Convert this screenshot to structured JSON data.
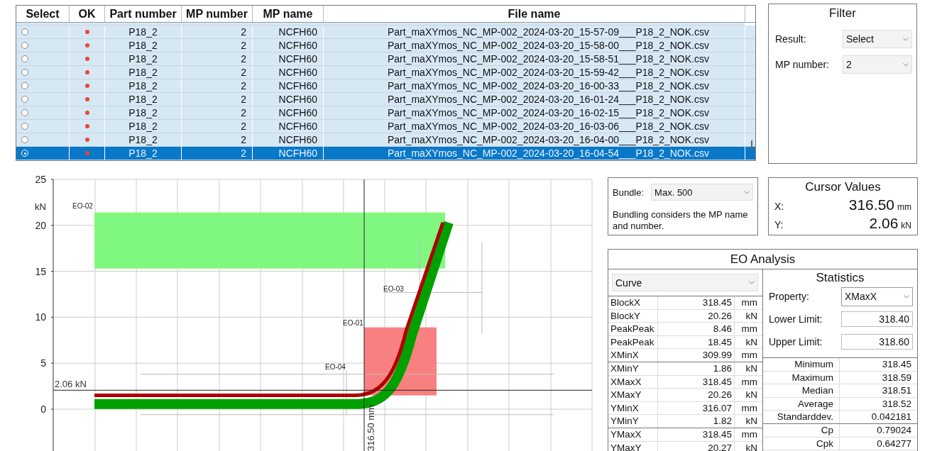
{
  "table": {
    "columns": [
      "Select",
      "OK",
      "Part number",
      "MP number",
      "MP name",
      "File name"
    ],
    "rows": [
      {
        "selected": false,
        "ok": false,
        "part_number": "P18_2",
        "mp_number": "2",
        "mp_name": "NCFH60",
        "file_name": "Part_maXYmos_NC_MP-002_2024-03-20_15-57-09___P18_2_NOK.csv"
      },
      {
        "selected": false,
        "ok": false,
        "part_number": "P18_2",
        "mp_number": "2",
        "mp_name": "NCFH60",
        "file_name": "Part_maXYmos_NC_MP-002_2024-03-20_15-58-00___P18_2_NOK.csv"
      },
      {
        "selected": false,
        "ok": false,
        "part_number": "P18_2",
        "mp_number": "2",
        "mp_name": "NCFH60",
        "file_name": "Part_maXYmos_NC_MP-002_2024-03-20_15-58-51___P18_2_NOK.csv"
      },
      {
        "selected": false,
        "ok": false,
        "part_number": "P18_2",
        "mp_number": "2",
        "mp_name": "NCFH60",
        "file_name": "Part_maXYmos_NC_MP-002_2024-03-20_15-59-42___P18_2_NOK.csv"
      },
      {
        "selected": false,
        "ok": false,
        "part_number": "P18_2",
        "mp_number": "2",
        "mp_name": "NCFH60",
        "file_name": "Part_maXYmos_NC_MP-002_2024-03-20_16-00-33___P18_2_NOK.csv"
      },
      {
        "selected": false,
        "ok": false,
        "part_number": "P18_2",
        "mp_number": "2",
        "mp_name": "NCFH60",
        "file_name": "Part_maXYmos_NC_MP-002_2024-03-20_16-01-24___P18_2_NOK.csv"
      },
      {
        "selected": false,
        "ok": false,
        "part_number": "P18_2",
        "mp_number": "2",
        "mp_name": "NCFH60",
        "file_name": "Part_maXYmos_NC_MP-002_2024-03-20_16-02-15___P18_2_NOK.csv"
      },
      {
        "selected": false,
        "ok": false,
        "part_number": "P18_2",
        "mp_number": "2",
        "mp_name": "NCFH60",
        "file_name": "Part_maXYmos_NC_MP-002_2024-03-20_16-03-06___P18_2_NOK.csv"
      },
      {
        "selected": false,
        "ok": false,
        "part_number": "P18_2",
        "mp_number": "2",
        "mp_name": "NCFH60",
        "file_name": "Part_maXYmos_NC_MP-002_2024-03-20_16-04-00___P18_2_NOK.csv"
      },
      {
        "selected": true,
        "ok": false,
        "part_number": "P18_2",
        "mp_number": "2",
        "mp_name": "NCFH60",
        "file_name": "Part_maXYmos_NC_MP-002_2024-03-20_16-04-54___P18_2_NOK.csv"
      }
    ]
  },
  "filter": {
    "title": "Filter",
    "fields": [
      {
        "label": "Result:",
        "value": "Select"
      },
      {
        "label": "MP number:",
        "value": "2"
      }
    ]
  },
  "plot": {
    "y_ticks": [
      "25",
      "20",
      "15",
      "10",
      "5",
      "0"
    ],
    "y_unit": "kN",
    "cursor_y_label": "2.06 kN",
    "cursor_x_label": "316.50 mm",
    "windows": [
      {
        "label": "EO-02"
      },
      {
        "label": "EO-03"
      },
      {
        "label": "EO-01"
      },
      {
        "label": "EO-04"
      }
    ]
  },
  "bundle": {
    "label": "Bundle:",
    "value": "Max. 500",
    "note": "Bundling considers the MP name and number."
  },
  "cursor_values": {
    "title": "Cursor Values",
    "rows": [
      {
        "label": "X:",
        "value": "316.50",
        "unit": "mm"
      },
      {
        "label": "Y:",
        "value": "2.06",
        "unit": "kN"
      }
    ]
  },
  "eo_analysis": {
    "title": "EO Analysis",
    "curve_select": "Curve",
    "results": [
      {
        "name": "BlockX",
        "value": "318.45",
        "unit": "mm"
      },
      {
        "name": "BlockY",
        "value": "20.26",
        "unit": "kN"
      },
      {
        "name": "PeakPeak",
        "value": "8.46",
        "unit": "mm"
      },
      {
        "name": "PeakPeak",
        "value": "18.45",
        "unit": "kN"
      },
      {
        "name": "XMinX",
        "value": "309.99",
        "unit": "mm"
      },
      {
        "name": "XMinY",
        "value": "1.86",
        "unit": "kN"
      },
      {
        "name": "XMaxX",
        "value": "318.45",
        "unit": "mm"
      },
      {
        "name": "XMaxY",
        "value": "20.26",
        "unit": "kN"
      },
      {
        "name": "YMinX",
        "value": "316.07",
        "unit": "mm"
      },
      {
        "name": "YMinY",
        "value": "1.82",
        "unit": "kN"
      },
      {
        "name": "YMaxX",
        "value": "318.45",
        "unit": "mm"
      },
      {
        "name": "YMaxY",
        "value": "20.27",
        "unit": "kN"
      }
    ],
    "statistics": {
      "title": "Statistics",
      "property_label": "Property:",
      "property": "XMaxX",
      "lower_label": "Lower Limit:",
      "lower": "318.40",
      "upper_label": "Upper Limit:",
      "upper": "318.60",
      "rows": [
        {
          "name": "Minimum",
          "value": "318.45"
        },
        {
          "name": "Maximum",
          "value": "318.59"
        },
        {
          "name": "Median",
          "value": "318.51"
        },
        {
          "name": "Average",
          "value": "318.52"
        },
        {
          "name": "Standarddev.",
          "value": "0.042181"
        },
        {
          "name": "Cp",
          "value": "0.79024"
        },
        {
          "name": "Cpk",
          "value": "0.64277"
        }
      ]
    }
  }
}
